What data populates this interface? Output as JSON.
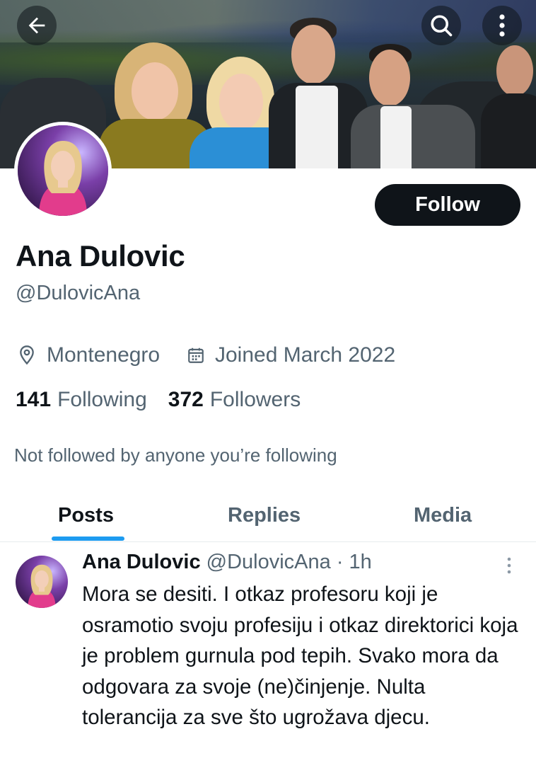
{
  "profile": {
    "name": "Ana Dulovic",
    "handle": "@DulovicAna",
    "location": "Montenegro",
    "joined": "Joined March 2022",
    "following_count": "141",
    "following_label": "Following",
    "followers_count": "372",
    "followers_label": "Followers",
    "not_followed_note": "Not followed by anyone you’re following"
  },
  "actions": {
    "follow_label": "Follow"
  },
  "icons": {
    "back": "arrow-left-icon",
    "search": "search-icon",
    "more": "more-vertical-icon",
    "location": "location-pin-icon",
    "calendar": "calendar-icon"
  },
  "tabs": [
    {
      "label": "Posts",
      "active": true
    },
    {
      "label": "Replies",
      "active": false
    },
    {
      "label": "Media",
      "active": false
    }
  ],
  "post": {
    "author_name": "Ana Dulovic",
    "author_handle": "@DulovicAna",
    "time": "· 1h",
    "text": "Mora se desiti. I otkaz profesoru koji je osramotio svoju profesiju i otkaz direktorici koja je problem gurnula pod tepih. Svako mora da odgovara za svoje (ne)činjenje. Nulta tolerancija za sve što ugrožava djecu."
  },
  "colors": {
    "accent": "#1d9bf0",
    "text_primary": "#0f1419",
    "text_secondary": "#536471",
    "button_bg": "#0f1419"
  }
}
